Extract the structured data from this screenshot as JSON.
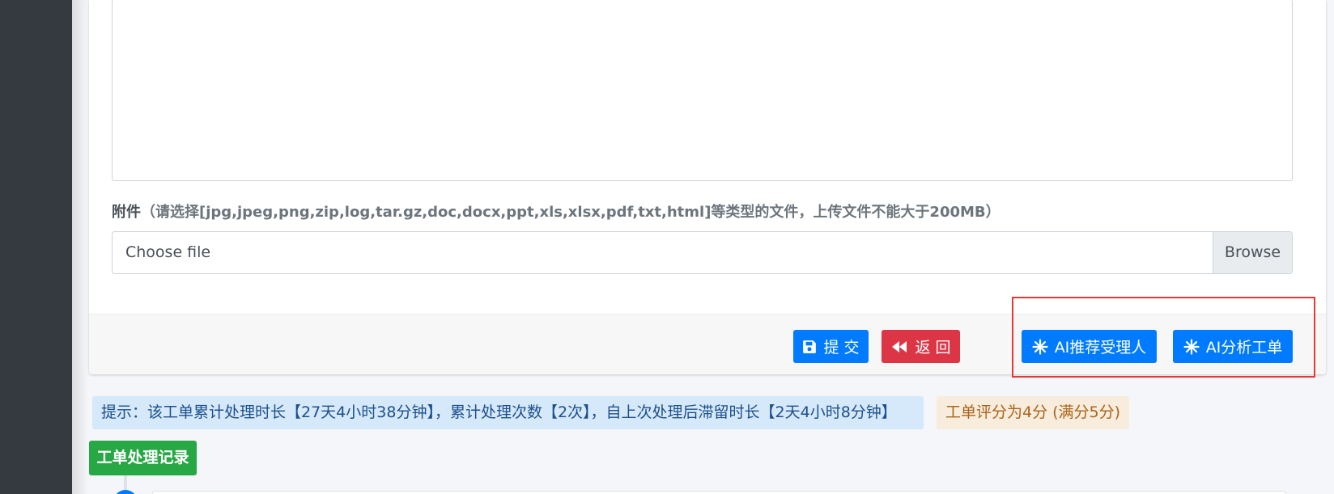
{
  "attachment": {
    "label": "附件",
    "hint": "（请选择[jpg,jpeg,png,zip,log,tar.gz,doc,docx,ppt,xls,xlsx,pdf,txt,html]等类型的文件，上传文件不能大于200MB）",
    "file_placeholder": "Choose file",
    "browse_label": "Browse"
  },
  "footer": {
    "submit_label": "提 交",
    "back_label": "返 回",
    "ai_recommend_label": "AI推荐受理人",
    "ai_analyze_label": "AI分析工单"
  },
  "alerts": {
    "info": "提示：该工单累计处理时长【27天4小时38分钟】，累计处理次数【2次】，自上次处理后滞留时长【2天4小时8分钟】",
    "rating": "工单评分为4分 (满分5分)"
  },
  "timeline": {
    "title": "工单处理记录"
  },
  "icons": {
    "submit": "save-icon",
    "back": "backward-icon",
    "ai": "sparkle-icon"
  },
  "colors": {
    "primary": "#007bff",
    "danger": "#dc3545",
    "success": "#28a745",
    "highlight": "#e53935"
  }
}
